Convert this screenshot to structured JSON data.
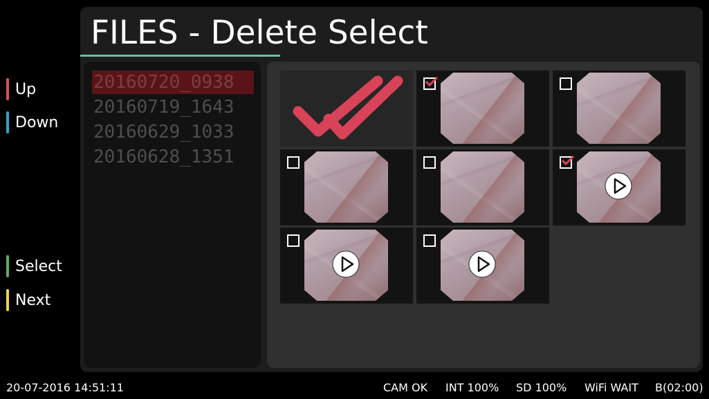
{
  "title": "FILES - Delete Select",
  "side_keys": [
    {
      "label": "Up",
      "color": "#d9505f"
    },
    {
      "label": "Down",
      "color": "#2aa7c4"
    },
    {
      "label": "Select",
      "color": "#5fae65"
    },
    {
      "label": "Next",
      "color": "#f0d44a"
    }
  ],
  "file_list": {
    "items": [
      "20160720_0938",
      "20160719_1643",
      "20160629_1033",
      "20160628_1351"
    ],
    "selected_index": 0
  },
  "tiles": [
    {
      "kind": "select-all"
    },
    {
      "kind": "image",
      "checked": true
    },
    {
      "kind": "image",
      "checked": false
    },
    {
      "kind": "image",
      "checked": false
    },
    {
      "kind": "image",
      "checked": false
    },
    {
      "kind": "video",
      "checked": true
    },
    {
      "kind": "video",
      "checked": false
    },
    {
      "kind": "video",
      "checked": false
    }
  ],
  "status": {
    "datetime": "20-07-2016 14:51:11",
    "cam": "CAM OK",
    "int": "INT 100%",
    "sd": "SD 100%",
    "wifi": "WiFi WAIT",
    "battery": "B(02:00)"
  },
  "colors": {
    "accent_check": "#d9435a",
    "title_underline": "#66c4a0",
    "selected_row": "#5a1418"
  }
}
